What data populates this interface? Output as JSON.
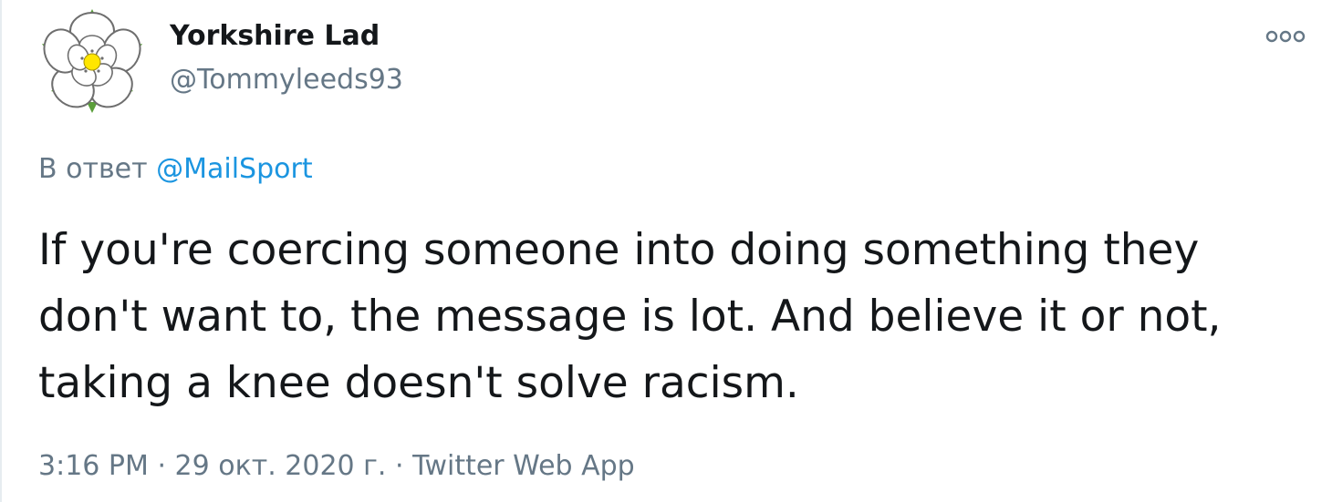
{
  "user": {
    "display_name": "Yorkshire Lad",
    "handle": "@Tommyleeds93",
    "avatar_icon": "yorkshire-rose-icon"
  },
  "menu": {
    "icon": "more-options-icon"
  },
  "reply": {
    "prefix": "В ответ",
    "mention": "@MailSport"
  },
  "tweet": {
    "lines": [
      "If you're coercing someone into doing something they",
      "don't want to, the message is lot. And believe it or not,",
      "taking a knee doesn't solve racism."
    ]
  },
  "meta": {
    "time": "3:16 PM",
    "separator": "·",
    "date": "29 окт. 2020 г.",
    "source": "Twitter Web App"
  },
  "colors": {
    "text": "#14171a",
    "secondary": "#657786",
    "link": "#1b95e0",
    "rose_leaf": "#5a9e3a",
    "rose_center": "#ffe600"
  }
}
